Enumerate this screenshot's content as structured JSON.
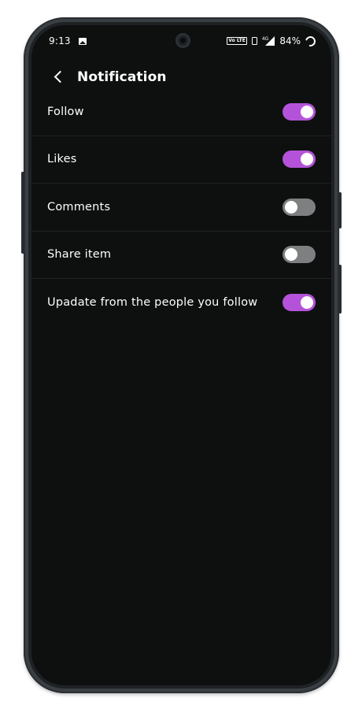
{
  "status_bar": {
    "time": "9:13",
    "network_type": "4G",
    "volte_label": "Vo LTE",
    "battery_percent": "84%",
    "icons": [
      "gallery-icon",
      "volte-icon",
      "vibrate-icon",
      "signal-icon",
      "battery-icon"
    ]
  },
  "header": {
    "title": "Notification",
    "back_icon": "back-arrow-icon"
  },
  "settings": [
    {
      "label": "Follow",
      "enabled": true
    },
    {
      "label": "Likes",
      "enabled": true
    },
    {
      "label": "Comments",
      "enabled": false
    },
    {
      "label": "Share item",
      "enabled": false
    },
    {
      "label": "Upadate from the people you follow",
      "enabled": true
    }
  ],
  "colors": {
    "background": "#0d100f",
    "toggle_on": "#b453d9",
    "toggle_off": "#7d7f80",
    "text": "#ffffff"
  }
}
